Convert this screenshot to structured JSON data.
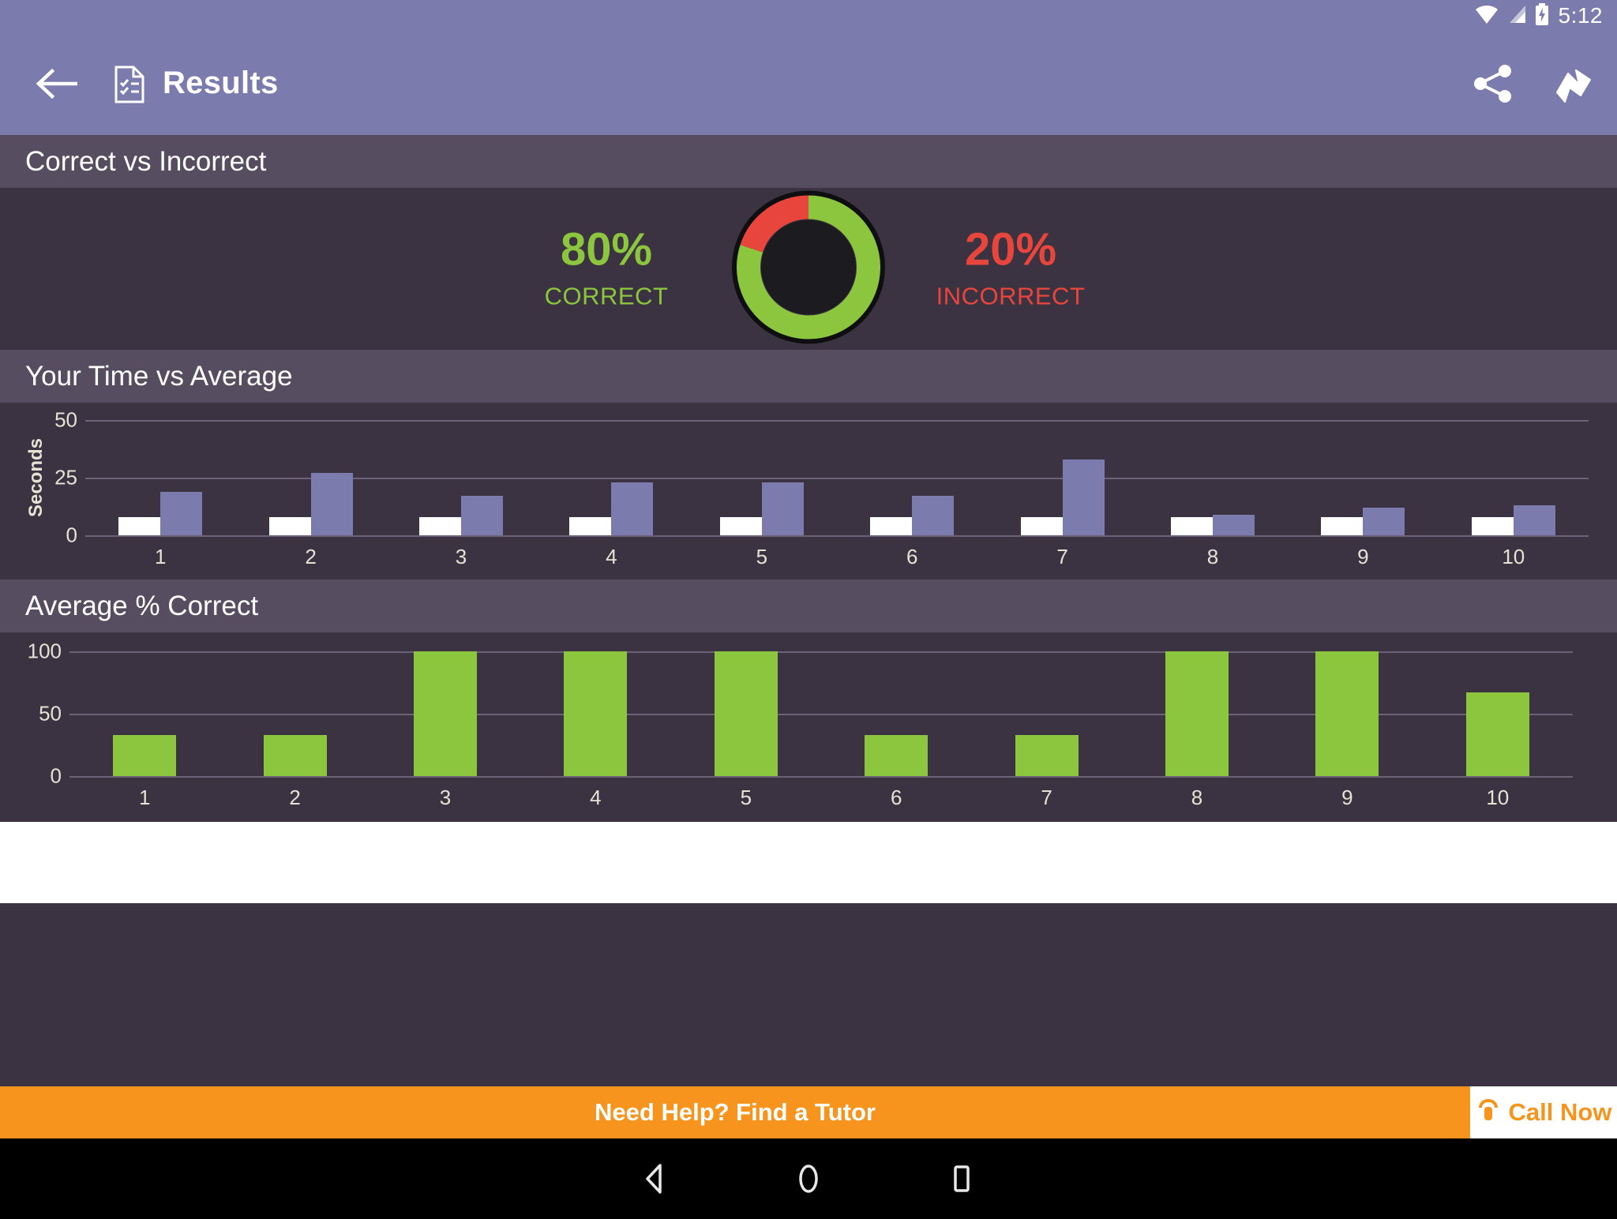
{
  "status_bar": {
    "time": "5:12",
    "icons": [
      "wifi-icon",
      "cell-signal-icon",
      "battery-charging-icon"
    ]
  },
  "app_bar": {
    "back_icon": "back-arrow-icon",
    "doc_icon": "results-document-icon",
    "title": "Results",
    "share_icon": "share-icon",
    "forward_icon": "forward-arrow-icon"
  },
  "sections": {
    "correct_vs_incorrect": "Correct vs Incorrect",
    "time_vs_average": "Your Time vs Average",
    "average_percent_correct": "Average % Correct"
  },
  "donut": {
    "correct_value": "80%",
    "correct_label": "CORRECT",
    "incorrect_value": "20%",
    "incorrect_label": "INCORRECT",
    "correct_color": "#8cc63e",
    "incorrect_color": "#e8453c"
  },
  "ad": {
    "text": "Need Help? Find a Tutor",
    "call_label": "Call Now",
    "phone_icon": "phone-icon",
    "bg_color": "#f7941e"
  },
  "nav_bar": {
    "back": "nav-back-icon",
    "home": "nav-home-icon",
    "recents": "nav-recents-icon"
  },
  "chart_data": [
    {
      "type": "bar",
      "title": "Your Time vs Average",
      "xlabel": "",
      "ylabel": "Seconds",
      "ylim": [
        0,
        50
      ],
      "yticks": [
        0,
        25,
        50
      ],
      "grid": true,
      "legend": "none",
      "categories": [
        "1",
        "2",
        "3",
        "4",
        "5",
        "6",
        "7",
        "8",
        "9",
        "10"
      ],
      "series": [
        {
          "name": "Your Time",
          "color": "#ffffff",
          "values": [
            8,
            8,
            8,
            8,
            8,
            8,
            8,
            8,
            8,
            8
          ]
        },
        {
          "name": "Average",
          "color": "#7b7bad",
          "values": [
            19,
            27,
            17,
            23,
            23,
            17,
            33,
            9,
            12,
            13
          ]
        }
      ]
    },
    {
      "type": "bar",
      "title": "Average % Correct",
      "xlabel": "",
      "ylabel": "",
      "ylim": [
        0,
        100
      ],
      "yticks": [
        0,
        50,
        100
      ],
      "grid": true,
      "legend": "none",
      "categories": [
        "1",
        "2",
        "3",
        "4",
        "5",
        "6",
        "7",
        "8",
        "9",
        "10"
      ],
      "series": [
        {
          "name": "Average % Correct",
          "color": "#8cc63e",
          "values": [
            33,
            33,
            100,
            100,
            100,
            33,
            33,
            100,
            100,
            67
          ]
        }
      ]
    }
  ]
}
